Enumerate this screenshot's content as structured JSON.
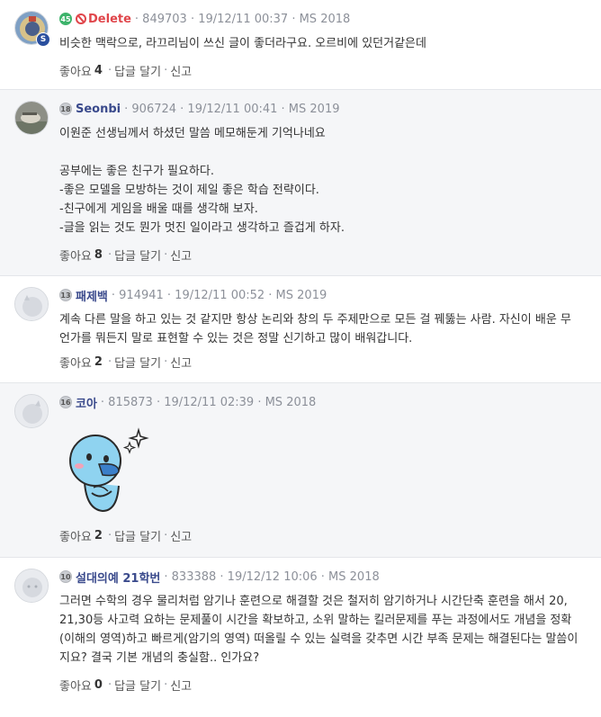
{
  "comments": [
    {
      "level": "45",
      "username": "Delete",
      "meta": "· 849703 · 19/12/11 00:37 · MS 2018",
      "text": "비슷한 맥락으로, 라끄리님이 쓰신 글이 좋더라구요. 오르비에 있던거같은데",
      "likes_label": "좋아요",
      "likes": "4",
      "reply": "답글 달기",
      "report": "신고",
      "avatar_badge": "S"
    },
    {
      "level": "18",
      "username": "Seonbi",
      "meta": "· 906724 · 19/12/11 00:41 · MS 2019",
      "text": "이원준 선생님께서 하셨던 말씀 메모해둔게 기억나네요\n\n공부에는 좋은 친구가 필요하다.\n-좋은 모델을 모방하는 것이 제일 좋은 학습 전략이다.\n-친구에게 게임을 배울 때를 생각해 보자.\n-글을 읽는 것도 뭔가 멋진 일이라고 생각하고 즐겁게 하자.",
      "likes_label": "좋아요",
      "likes": "8",
      "reply": "답글 달기",
      "report": "신고"
    },
    {
      "level": "13",
      "username": "패제백",
      "meta": "· 914941 · 19/12/11 00:52 · MS 2019",
      "text": "계속 다른 말을 하고 있는 것 같지만 항상 논리와 창의 두 주제만으로 모든 걸 꿰뚫는 사람. 자신이 배운 무언가를 뭐든지 말로 표현할 수 있는 것은 정말 신기하고 많이 배워갑니다.",
      "likes_label": "좋아요",
      "likes": "2",
      "reply": "답글 달기",
      "report": "신고"
    },
    {
      "level": "16",
      "username": "코아",
      "meta": "· 815873 · 19/12/11 02:39 · MS 2018",
      "likes_label": "좋아요",
      "likes": "2",
      "reply": "답글 달기",
      "report": "신고"
    },
    {
      "level": "10",
      "username": "설대의예 21학번",
      "meta": "· 833388 · 19/12/12 10:06 · MS 2018",
      "text": "그러면 수학의 경우 물리처럼 암기나 훈련으로 해결할 것은 철저히 암기하거나 시간단축 훈련을 해서 20, 21,30등 사고력 요하는 문제풀이 시간을 확보하고, 소위 말하는 킬러문제를 푸는 과정에서도 개념을 정확(이해의 영역)하고 빠르게(암기의 영역) 떠올릴 수 있는 실력을 갖추면 시간 부족 문제는 해결된다는 말씀이지요? 결국 기본 개념의 충실함.. 인가요?",
      "likes_label": "좋아요",
      "likes": "0",
      "reply": "답글 달기",
      "report": "신고"
    }
  ],
  "colors": {
    "username": "#3a4a8c",
    "deleted": "#e0464b",
    "meta": "#8c9099",
    "gray_bg": "#f5f6f8"
  }
}
